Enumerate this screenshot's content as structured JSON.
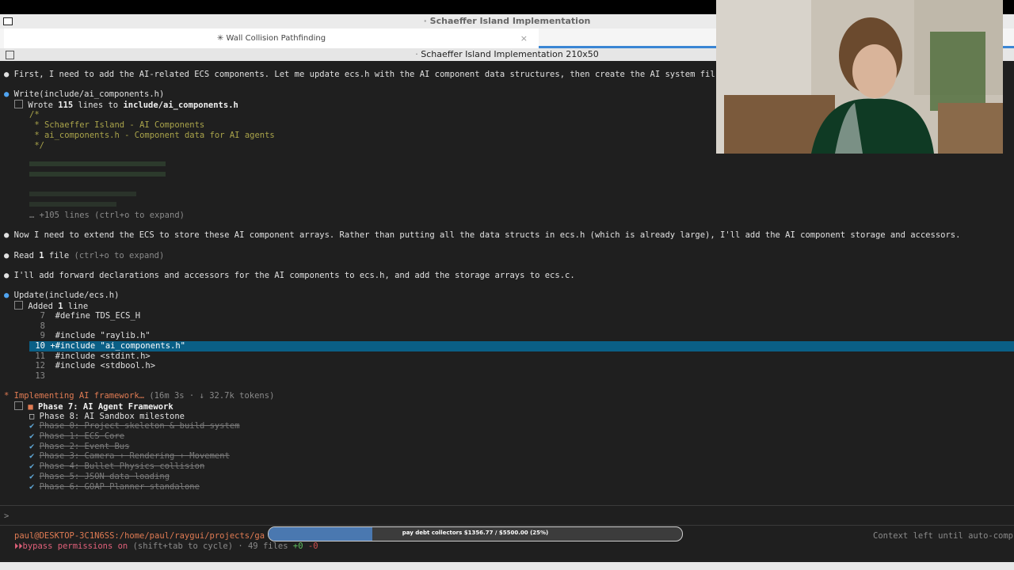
{
  "window": {
    "title": "Schaeffer Island Implementation"
  },
  "tab": {
    "label": "✳ Wall Collision Pathfinding",
    "close": "×"
  },
  "pane": {
    "title": "Schaeffer Island Implementation 210x50"
  },
  "transcript": {
    "intro": "First, I need to add the AI-related ECS components. Let me update ecs.h with the AI component data structures, then create the AI system fil",
    "write_call": "Write(include/ai_components.h)",
    "write_result_prefix": "Wrote ",
    "write_result_count": "115",
    "write_result_mid": " lines to ",
    "write_result_file": "include/ai_components.h",
    "code_preview": [
      "/*",
      " * Schaeffer Island - AI Components",
      " * ai_components.h - Component data for AI agents",
      " */"
    ],
    "more_lines": "… +105 lines (ctrl+o to expand)",
    "extend_msg": "Now I need to extend the ECS to store these AI component arrays. Rather than putting all the data structs in ecs.h (which is already large), I'll add the AI component storage and accessors.",
    "read_label": "Read ",
    "read_count": "1",
    "read_file": " file",
    "read_hint": " (ctrl+o to expand)",
    "forward_msg": "I'll add forward declarations and accessors for the AI components to ecs.h, and add the storage arrays to ecs.c.",
    "update_call": "Update(include/ecs.h)",
    "update_result_prefix": "Added ",
    "update_result_count": "1",
    "update_result_suffix": " line",
    "diff": [
      {
        "n": "7",
        "code": "  #define TDS_ECS_H"
      },
      {
        "n": "8",
        "code": ""
      },
      {
        "n": "9",
        "code": "  #include \"raylib.h\""
      },
      {
        "n": "10",
        "code": " +#include \"ai_components.h\""
      },
      {
        "n": "11",
        "code": "  #include <stdint.h>"
      },
      {
        "n": "12",
        "code": "  #include <stdbool.h>"
      },
      {
        "n": "13",
        "code": ""
      }
    ],
    "status": "Implementing AI framework…",
    "status_meta": " (16m 3s · ↓ 32.7k tokens)",
    "phases": [
      {
        "mark": "■",
        "label": "Phase 7: AI Agent Framework",
        "state": "active"
      },
      {
        "mark": "□",
        "label": "Phase 8: AI Sandbox milestone",
        "state": "pending"
      },
      {
        "mark": "✔",
        "label": "Phase 0: Project skeleton & build system",
        "state": "done"
      },
      {
        "mark": "✔",
        "label": "Phase 1: ECS Core",
        "state": "done"
      },
      {
        "mark": "✔",
        "label": "Phase 2: Event Bus",
        "state": "done"
      },
      {
        "mark": "✔",
        "label": "Phase 3: Camera + Rendering + Movement",
        "state": "done"
      },
      {
        "mark": "✔",
        "label": "Phase 4: Bullet Physics collision",
        "state": "done"
      },
      {
        "mark": "✔",
        "label": "Phase 5: JSON data loading",
        "state": "done"
      },
      {
        "mark": "✔",
        "label": "Phase 6: GOAP Planner standalone",
        "state": "done"
      }
    ]
  },
  "prompt": {
    "symbol": ">"
  },
  "footer": {
    "path": "paul@DESKTOP-3C1N6SS:/home/paul/raygui/projects/ga",
    "context": "Context left until auto-comp",
    "bypass": "bypass permissions on",
    "bypass_hint": " (shift+tab to cycle) · 49 files ",
    "files_plus": "+0",
    "files_minus": " -0"
  },
  "overlay": {
    "progress_label": "pay debt collectors $1356.77 / $5500.00 (25%)",
    "progress_fraction": 0.25
  },
  "colors": {
    "accent": "#e07b53",
    "highlight": "#0a5f86",
    "tab_accent": "#3a86d4"
  }
}
